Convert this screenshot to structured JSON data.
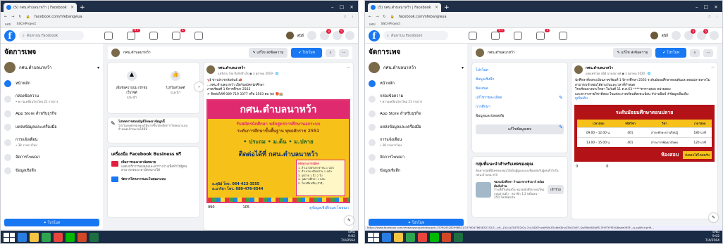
{
  "browser": {
    "tab_title": "(5) กศน.ตำบลนาหว้า | Facebook",
    "close_glyph": "×",
    "newtab_glyph": "+",
    "url": "facebook.com/nfebangwua",
    "bookmarks": [
      "แอป",
      "SSCHProject"
    ],
    "win_controls": [
      "–",
      "□",
      "×"
    ],
    "status_url": "https://www.facebook.com/nfebangwua/photos/pcb.1576045282998811/1576047865832152/?__cft__[0]=AZXE7E2IGv-7uLQDXTvvbHWnZ5x8nK8nvZ5kG3t5F_Qp5Bhk8ZqRS-3FHTYFfS5Q6ade0RSF-_q_sqWrLhpH9..."
  },
  "fb": {
    "search_placeholder": "ค้นหาบน Facebook",
    "badges": {
      "watch": "9+",
      "groups": "1"
    },
    "user_name": "สุนิย์",
    "notif_badges": [
      "3",
      "5"
    ]
  },
  "sidebar": {
    "title": "จัดการเพจ",
    "page_name": "กศน.ตำบลนาหว้า",
    "dropdown_glyph": "▾",
    "items": [
      {
        "label": "หน้าหลัก",
        "sub": ""
      },
      {
        "label": "กล่องข้อความ",
        "sub": "• ความเคลื่อนไหวใหม่ 21 รายการ"
      },
      {
        "label": "App Store สำหรับธุรกิจ",
        "sub": ""
      },
      {
        "label": "แหล่งข้อมูลและเครื่องมือ",
        "sub": ""
      },
      {
        "label": "การแจ้งเตือน",
        "sub": "• 38 รายการใหม่"
      },
      {
        "label": "จัดการโฆษณา",
        "sub": ""
      },
      {
        "label": "ข้อมูลเชิงลึก",
        "sub": ""
      }
    ],
    "promote_label": "✦ โปรโมท"
  },
  "page_header": {
    "page_name": "กศน.ตำบลนาหว้า",
    "edit_label": "✎ แก้ไข ส่งข้อความ",
    "send_label": "✔ โปรโมท",
    "search_glyph": "⌕",
    "more_glyph": "···"
  },
  "left_screen": {
    "tools": [
      {
        "label": "เพิ่มข้อความปุ่ม เข้าชมเว็บไซต์",
        "sub": "แนะนำ"
      },
      {
        "label": "ไปรโมทโพสต์",
        "sub": "แนะนำ"
      }
    ],
    "next_glyph": "›",
    "tip_title": "โปรดตรวจสอบบัญชีโฆษณาข้อมูลนี้",
    "tip_body": "โปรโมทเพจของคุณให้มากขึ้นโดยจัดการโฆษณาแบบกำหนดเป้าหมายได้ที่นี่",
    "tools_heading": "เครื่องมือ Facebook Business ฟรี",
    "tools_item1": "เพิ่มการจองเวลานัดหมาย",
    "tools_item1_sub": "แสดงบริการของคุณและตารางว่างเพื่อทำให้ผู้คนสามารถจองเวลานัดหมายได้",
    "tools_item2": "จัดการโครงการและโฆษณาแบบ",
    "post_author": "กศน.ตำบลนาหว้า",
    "post_meta": "แชร์ผ่าน Siu Ramith Zs ● 3 ตุลาคม 2019 · 🌐",
    "post_lines": [
      "📢 ข่าวประชาสัมพันธ์ 📣",
      "...กศน.ตำบลนาหว้า เปิดรับสมัครนักศึกษา",
      "ภาคเรียนที่ 1 ปีการศึกษา 2563",
      "✔ ติดต่อได้ที่ 089 719 3377 หรือ 2563 ตบ (พ) 🎁🏫"
    ],
    "poster": {
      "head": "กศน.ตำบลนาหว้า",
      "sub1": "รับสมัครนักศึกษา หลักสูตรการศึกษานอกระบบ",
      "sub2": "ระดับการศึกษาขั้นพื้นฐาน พุทธศักราช 2551",
      "sub3": "• ประถม  • ม.ต้น  • ม.ปลาย",
      "sub4": "ติดต่อได้ที่ กศน.ตำบลนาหว้า",
      "contact": [
        "อ.สุนิย์  โทร. 064-423-3555",
        "อ.มาริยา  โทร. 089-476-6544"
      ],
      "list_title": "หลักฐานการสมัคร",
      "list": [
        "1. สำเนาบัตรประชาชน 1 ฉบับ",
        "2. สำเนาทะเบียนบ้าน 1 ฉบับ",
        "3. รูปถ่าย 1 นิ้ว 2 ใบ",
        "4. วุฒิการศึกษา 1 ฉบับ",
        "5. ใบเปลี่ยนชื่อ (ถ้ามี)"
      ]
    },
    "stats": [
      "990",
      "105"
    ],
    "see_more": "ดูข้อมูลเชิงลึกและโฆษณา"
  },
  "right_screen": {
    "menu_items": [
      "โปรโมท",
      "ข้อมูลเชิงลึก",
      "ข้อเสนอ",
      "แก้ไขรายละเอียด",
      "การศึกษา",
      "ข้อมูลและปลอดภัย"
    ],
    "edit_info_label": "แก้ไขข้อมูลเพจ",
    "groups_heading": "กลุ่มที่แนะนำสำหรับเพจของคุณ",
    "groups_sub": "ค้นหากลุ่มที่มีเพจของคุณได้เป็นผู้ดูแลและเชื่อมต่อกับผู้คนทั่วไปใน กศน.ตำบลนาหว้า",
    "group_name": "ชมรมนักศึกษา ร้านอาหารชิวบาร์ คล้องคันกับร้าน",
    "group_sub": "ร้านที่ดีในท้องถิ่น ชมรมนักศึกษาคนใหม่",
    "group_meta": "กลุ่มส่วนตัว · สมาชิก 1.2 หมื่นคน · 250 โพสต์ต่อวัน",
    "join_label": "เข้าร่วม",
    "post_author": "กศน.ตำบลนาหว้า",
    "post_meta": "เผยแพร่โดย สุนิย์ นาคสมวงค์ ● 1 ตุลาคม 2020 · 🌐",
    "post_lines": [
      "นักศึกษาที่ลงทะเบียนภาคเรียนที่ 1 ปีการศึกษา 2563 ระดับมัธยมศึกษาตอนต้นและตอนปลายหากไม่สามารถเข้าสอบได้ตามวันและเวลาที่กำหนด",
      "โรงเรียนบางพระวิทยา ในวันที่ 11 ต.ค.63 *****ตารางสอบ หน่วยสอบ",
      "และตารางรายวิชาที่สอบ ในแต่ละภาคเรียนที่ลงทะเบียน #อ่านพิมพ์ #ข้อมูลเพิ่มเติม"
    ],
    "see_more_link": "ดูเพิ่มเติม",
    "schedule_title": "ระดับมัธยมศึกษาตอนปลาย",
    "schedule_headers": [
      "เวลาสอบ",
      "รหัสวิชา",
      "วิชา",
      "เวลาสอบ"
    ],
    "schedule_rows": [
      [
        "09.00 – 12.00 น.",
        "401",
        "สาระทักษะการเรียนรู้",
        "180 นาที"
      ],
      [
        "13.00 – 15.00 น.",
        "401",
        "สาระการพัฒนาสังคม",
        "120 นาที"
      ]
    ],
    "footer_text": "ห้องสอบ",
    "footer_sub": "ยังสอบได้ไหมครับ",
    "stats": [
      "0",
      "0"
    ]
  },
  "taskbar": {
    "time": "9:02",
    "date": "7/4/2564",
    "lang": "ENG"
  }
}
